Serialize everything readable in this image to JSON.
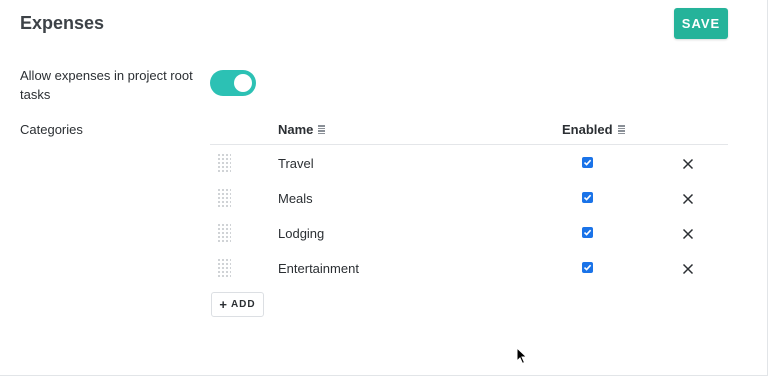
{
  "header": {
    "title": "Expenses",
    "save_label": "SAVE"
  },
  "settings": {
    "allow_label": "Allow expenses in project root tasks",
    "allow_enabled": true,
    "categories_label": "Categories"
  },
  "table": {
    "columns": {
      "name": "Name",
      "enabled": "Enabled"
    },
    "rows": [
      {
        "name": "Travel",
        "enabled": true
      },
      {
        "name": "Meals",
        "enabled": true
      },
      {
        "name": "Lodging",
        "enabled": true
      },
      {
        "name": "Entertainment",
        "enabled": true
      }
    ],
    "add_label": "ADD"
  },
  "colors": {
    "accent": "#25b39a",
    "toggle": "#2cc1b4",
    "checkbox": "#1a73e8"
  },
  "icons": {
    "sort": "sort-lines-icon",
    "delete": "close-icon",
    "drag": "drag-handle-icon",
    "add": "plus-icon"
  }
}
